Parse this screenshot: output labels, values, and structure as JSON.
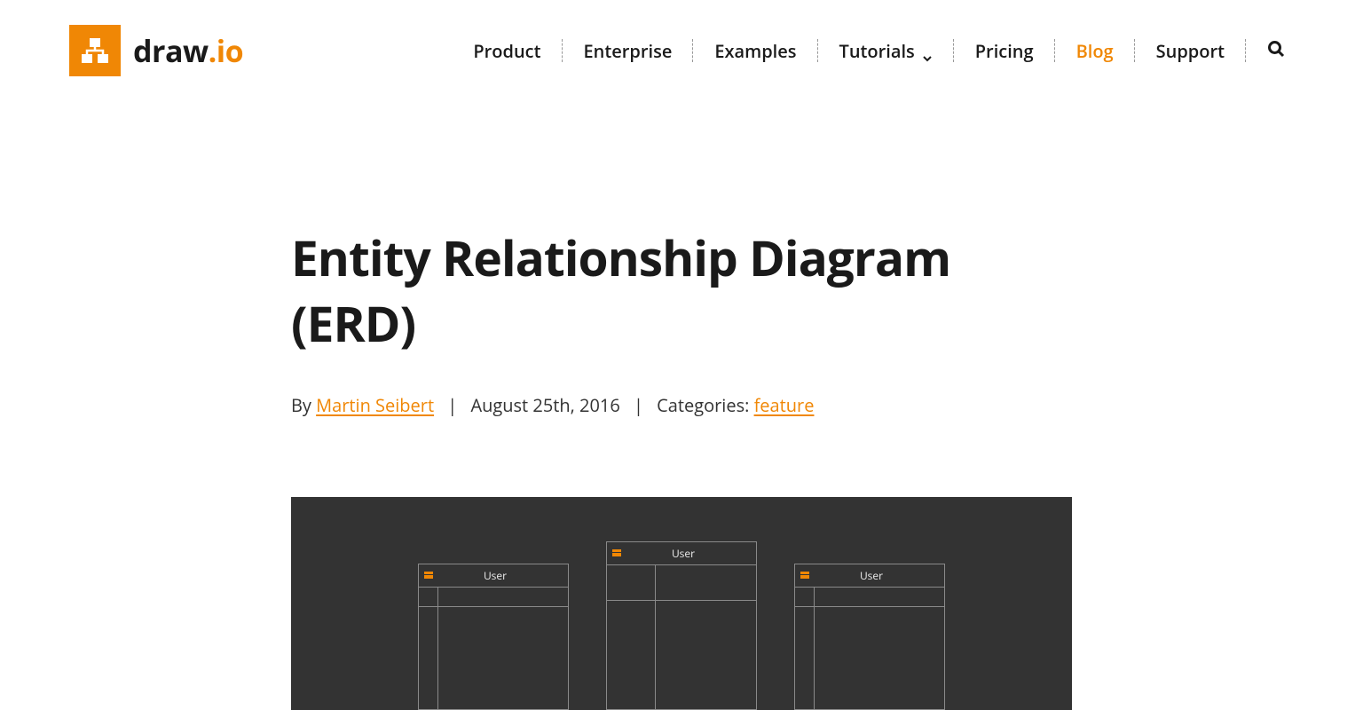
{
  "brand": {
    "name_first": "draw",
    "name_dot": ".",
    "name_last": "io"
  },
  "nav": {
    "items": [
      {
        "label": "Product",
        "active": false,
        "has_submenu": false
      },
      {
        "label": "Enterprise",
        "active": false,
        "has_submenu": false
      },
      {
        "label": "Examples",
        "active": false,
        "has_submenu": false
      },
      {
        "label": "Tutorials",
        "active": false,
        "has_submenu": true
      },
      {
        "label": "Pricing",
        "active": false,
        "has_submenu": false
      },
      {
        "label": "Blog",
        "active": true,
        "has_submenu": false
      },
      {
        "label": "Support",
        "active": false,
        "has_submenu": false
      }
    ]
  },
  "article": {
    "title": "Entity Relationship Diagram (ERD)",
    "by_prefix": "By ",
    "author": "Martin Seibert",
    "date": "August 25th, 2016",
    "categories_prefix": "Categories: ",
    "category": "feature"
  },
  "diagram": {
    "tables": [
      {
        "title": "User"
      },
      {
        "title": "User"
      },
      {
        "title": "User"
      }
    ]
  }
}
